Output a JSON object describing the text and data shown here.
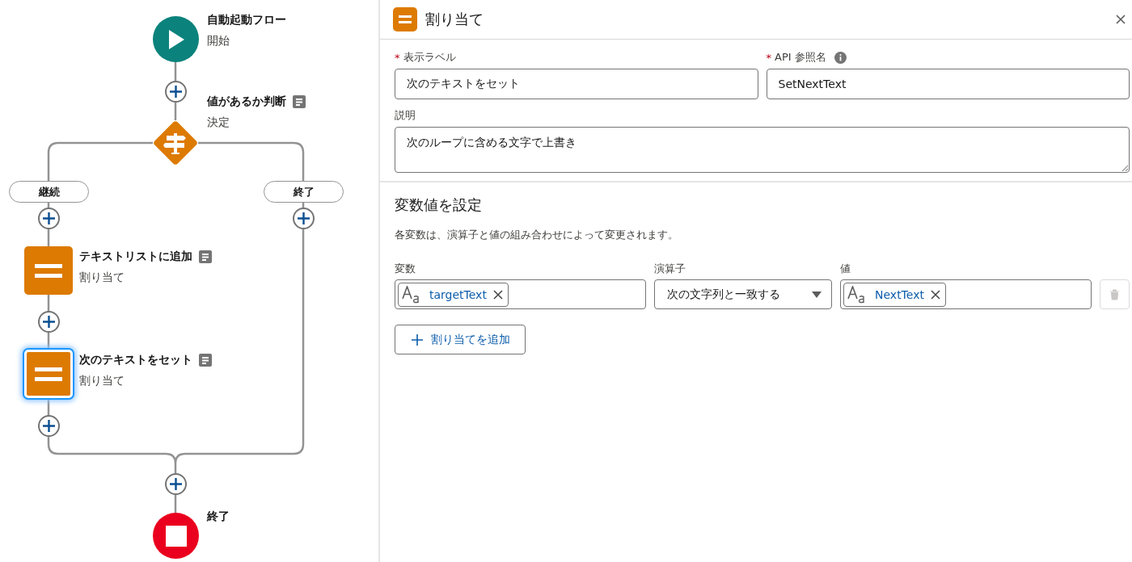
{
  "canvas": {
    "nodes": [
      {
        "kind": "start",
        "title": "自動起動フロー",
        "subtitle": "開始",
        "selected": false
      },
      {
        "kind": "decision",
        "title": "値があるか判断",
        "subtitle": "決定",
        "selected": false
      },
      {
        "kind": "assignment",
        "title": "テキストリストに追加",
        "subtitle": "割り当て",
        "selected": false
      },
      {
        "kind": "assignment",
        "title": "次のテキストをセット",
        "subtitle": "割り当て",
        "selected": true
      },
      {
        "kind": "end",
        "title": "終了",
        "selected": false
      }
    ],
    "branches": [
      {
        "label": "継続"
      },
      {
        "label": "終了"
      }
    ]
  },
  "panel": {
    "title": "割り当て",
    "fields": [
      {
        "required_mark": "*",
        "label": "表示ラベル",
        "value": "次のテキストをセット",
        "info": false
      },
      {
        "required_mark": "*",
        "label": "API 参照名",
        "value": "SetNextText",
        "info": true
      }
    ],
    "description": {
      "label": "説明",
      "value": "次のループに含める文字で上書き"
    },
    "section": {
      "title": "変数値を設定",
      "text": "各変数は、演算子と値の組み合わせによって変更されます。",
      "columns": [
        "変数",
        "演算子",
        "値"
      ],
      "rows": [
        {
          "variable": "targetText",
          "operator": "次の文字列と一致する",
          "value": "NextText",
          "delete_disabled": true
        }
      ],
      "add_button": "割り当てを追加"
    }
  }
}
